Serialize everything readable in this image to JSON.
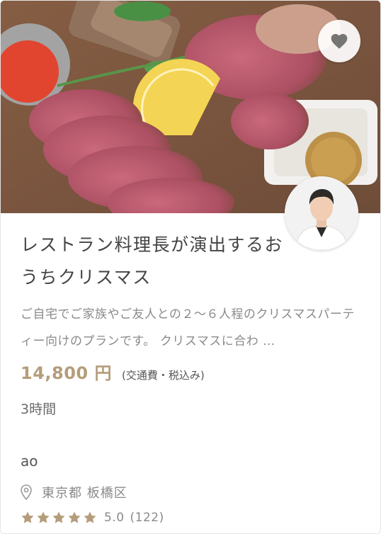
{
  "listing": {
    "title": "レストラン料理長が演出するおうちクリスマス",
    "description": "ご自宅でご家族やご友人との２〜６人程のクリスマスパーティー向けのプランです。 クリスマスに合わ …",
    "price": "14,800 円",
    "price_note": "(交通費・税込み)",
    "duration": "3時間",
    "host_name": "ao",
    "location": "東京都 板橋区",
    "rating": "5.0",
    "review_count": "(122)",
    "rating_stars": 5
  },
  "icons": {
    "favorite": "heart-icon",
    "location": "location-pin-icon",
    "rating": "star-icon"
  },
  "colors": {
    "price": "#b49d7a",
    "star": "#b49d7a",
    "text_muted": "#8a8a8a"
  }
}
